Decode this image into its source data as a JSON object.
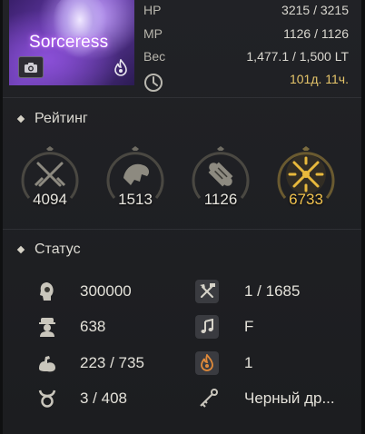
{
  "character": {
    "name": "Sorceress",
    "camera_icon": "camera-icon",
    "class_icon": "flame-class-icon"
  },
  "stats_top": [
    {
      "label": "HP",
      "value": "3215 / 3215"
    },
    {
      "label": "MP",
      "value": "1126 / 1126"
    },
    {
      "label": "Вес",
      "value": "1,477.1 / 1,500 LT"
    }
  ],
  "playtime": {
    "icon": "clock-icon",
    "value": "101д. 11ч."
  },
  "rating": {
    "title": "Рейтинг",
    "items": [
      {
        "icon": "crossed-swords-icon",
        "value": "4094"
      },
      {
        "icon": "beast-icon",
        "value": "1513"
      },
      {
        "icon": "scroll-icon",
        "value": "1126"
      },
      {
        "icon": "golden-crossed-swords-icon",
        "value": "6733"
      }
    ]
  },
  "status": {
    "title": "Статус",
    "left": [
      {
        "icon": "head-icon",
        "value": "300000"
      },
      {
        "icon": "officer-icon",
        "value": "638"
      },
      {
        "icon": "flexed-arm-icon",
        "value": "223 / 735"
      },
      {
        "icon": "taurus-icon",
        "value": "3 / 408"
      }
    ],
    "right": [
      {
        "icon": "axe-hammer-icon",
        "value": "1 / 1685"
      },
      {
        "icon": "music-note-icon",
        "value": "F"
      },
      {
        "icon": "fire-icon",
        "value": "1"
      },
      {
        "icon": "key-icon",
        "value": "Черный др..."
      }
    ]
  },
  "colors": {
    "gold": "#e6c56a",
    "accent": "#f1c34f",
    "background": "#1e1f22"
  }
}
